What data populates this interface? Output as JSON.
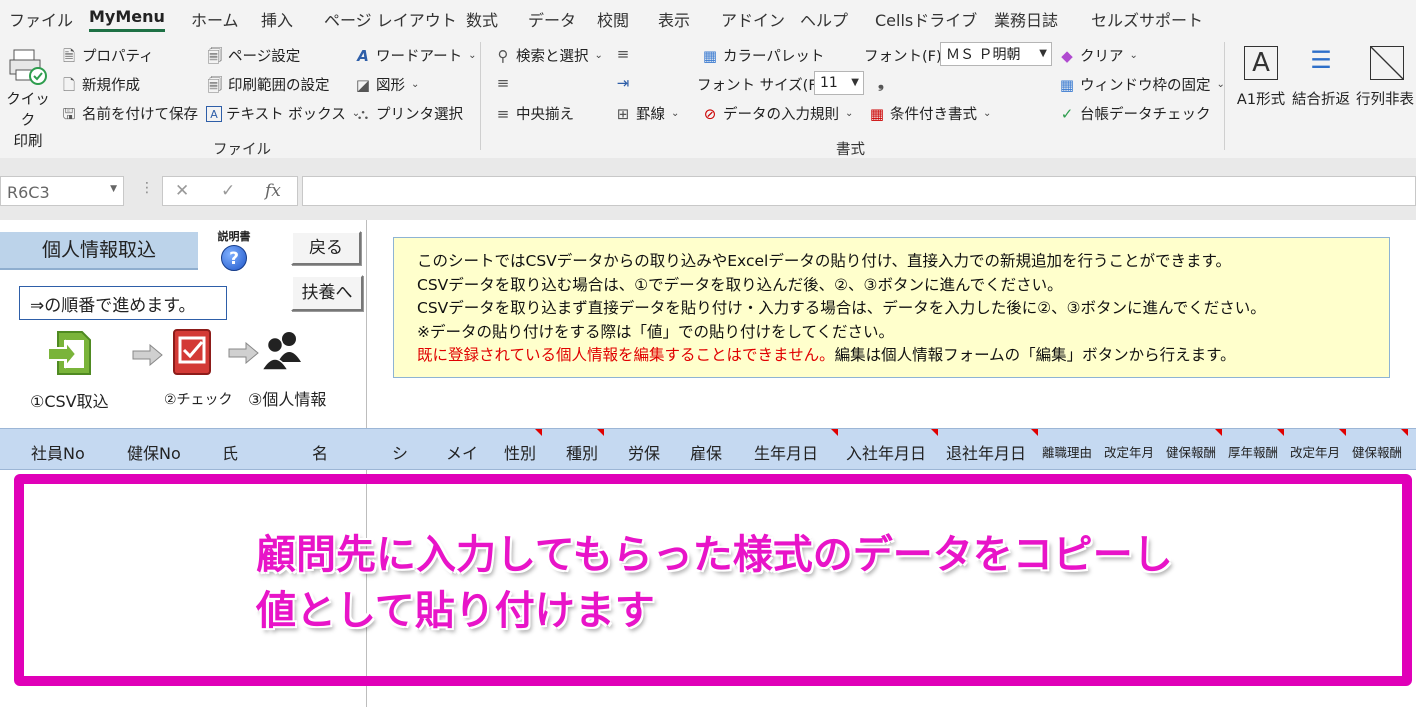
{
  "tabs": [
    "ファイル",
    "MyMenu",
    "ホーム",
    "挿入",
    "ページ レイアウト",
    "数式",
    "データ",
    "校閲",
    "表示",
    "アドイン",
    "ヘルプ",
    "Cellsドライブ",
    "業務日誌",
    "セルズサポート"
  ],
  "ribbon": {
    "file_group": {
      "quick_print": [
        "クイック",
        "印刷"
      ],
      "properties": "プロパティ",
      "new": "新規作成",
      "save_as": "名前を付けて保存",
      "page_setup": "ページ設定",
      "print_area": "印刷範囲の設定",
      "textbox": "テキスト ボックス",
      "wordart": "ワードアート",
      "shapes": "図形",
      "printer": "プリンタ選択",
      "label": "ファイル"
    },
    "format_group": {
      "find_select": "検索と選択",
      "center": "中央揃え",
      "borders": "罫線",
      "palette": "カラーパレット",
      "font_label": "フォント(F):",
      "font_value": "ＭＳ Ｐ明朝",
      "size_label": "フォント サイズ(F):",
      "size_value": "11",
      "validation": "データの入力規則",
      "conditional": "条件付き書式",
      "clear": "クリア",
      "freeze": "ウィンドウ枠の固定",
      "ledger_check": "台帳データチェック",
      "label": "書式"
    },
    "extra": {
      "a1": "A1形式",
      "wrap": "結合折返",
      "hide": "行列非表"
    }
  },
  "formula_bar": {
    "name_box": "R6C3",
    "cancel": "✕",
    "enter": "✓",
    "fx": "fx",
    "value": ""
  },
  "sheet": {
    "title": "個人情報取込",
    "manual_label": "説明書",
    "back_button": "戻る",
    "dependents_button": "扶養へ",
    "order_note": "⇒の順番で進めます。",
    "steps": [
      "①CSV取込",
      "②チェック",
      "③個人情報"
    ],
    "info_lines": [
      "このシートではCSVデータからの取り込みやExcelデータの貼り付け、直接入力での新規追加を行うことができます。",
      "CSVデータを取り込む場合は、①でデータを取り込んだ後、②、③ボタンに進んでください。",
      "CSVデータを取り込まず直接データを貼り付け・入力する場合は、データを入力した後に②、③ボタンに進んでください。",
      "※データの貼り付けをする際は「値」での貼り付けをしてください。"
    ],
    "info_red": "既に登録されている個人情報を編集することはできません。",
    "info_last": "編集は個人情報フォームの「編集」ボタンから行えます。",
    "headers": [
      "社員No",
      "健保No",
      "氏",
      "名",
      "シ",
      "メイ",
      "性別",
      "種別",
      "労保",
      "雇保",
      "生年月日",
      "入社年月日",
      "退社年月日",
      "離職理由",
      "改定年月",
      "健保報酬",
      "厚年報酬",
      "改定年月",
      "健保報酬"
    ]
  },
  "annotation": {
    "line1": "顧問先に入力してもらった様式のデータをコピーし",
    "line2": "値として貼り付けます",
    "color": "#e000b8"
  }
}
